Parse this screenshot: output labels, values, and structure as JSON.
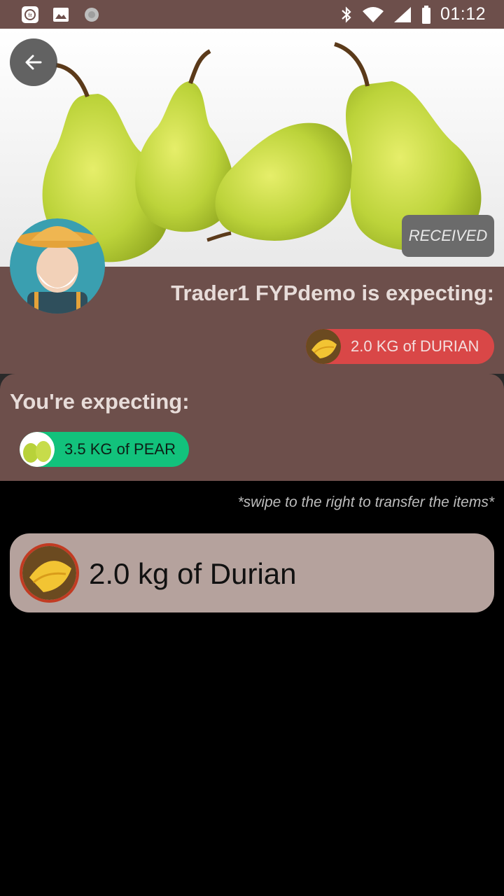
{
  "status_bar": {
    "time": "01:12",
    "left_icons": [
      "fit-app-icon",
      "image-icon",
      "loading-icon"
    ],
    "right_icons": [
      "bluetooth-icon",
      "wifi-icon",
      "signal-icon",
      "battery-icon"
    ]
  },
  "header": {
    "back_icon": "arrow-left-icon",
    "status_badge": "RECEIVED"
  },
  "trader": {
    "title": "Trader1 FYPdemo is expecting:",
    "item": "2.0 KG of DURIAN"
  },
  "you": {
    "title": "You're expecting:",
    "item": "3.5 KG of PEAR"
  },
  "hint": "*swipe to the right to transfer the items*",
  "transfer_items": [
    {
      "label": "2.0 kg of Durian"
    }
  ],
  "colors": {
    "panel": "#6d4f4b",
    "trader_chip": "#d94747",
    "you_chip": "#12c27c",
    "card": "#b5a29d",
    "card_ring": "#c23b22"
  }
}
